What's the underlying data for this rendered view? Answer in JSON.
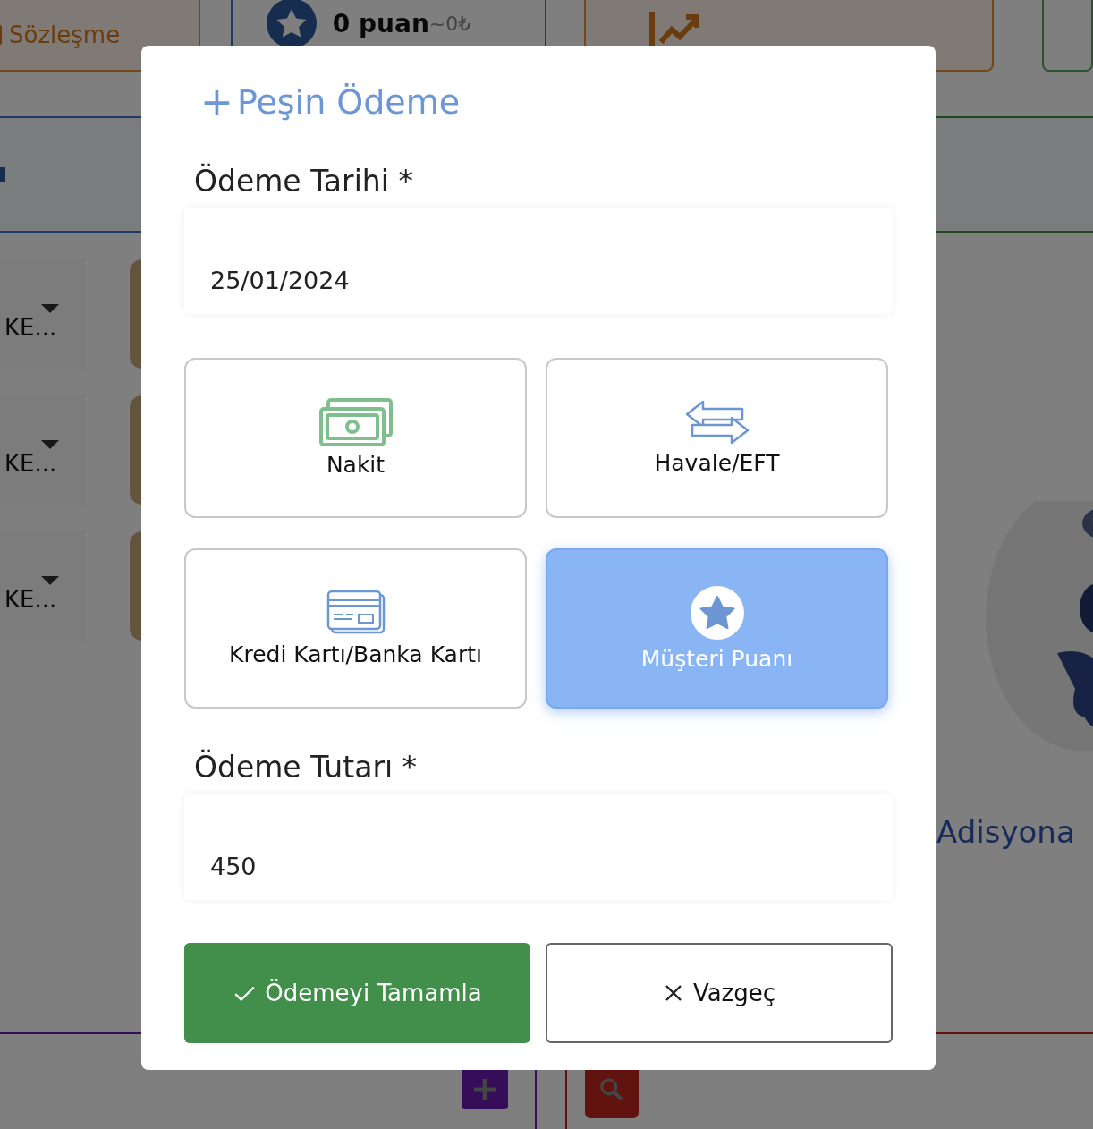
{
  "background": {
    "contract_card": {
      "label": "Sözleşme"
    },
    "points_card": {
      "value": "0 puan",
      "approx": "~0₺"
    },
    "rows": [
      {
        "label": "KE..."
      },
      {
        "label": "KE..."
      },
      {
        "label": "KE..."
      }
    ],
    "side_link": "Adisyona"
  },
  "dialog": {
    "title": "Peşin Ödeme",
    "title_icon": "+",
    "date_label": "Ödeme Tarihi *",
    "date_value": "25/01/2024",
    "methods": [
      {
        "kind": "cash",
        "label": "Nakit",
        "selected": false
      },
      {
        "kind": "transfer",
        "label": "Havale/EFT",
        "selected": false
      },
      {
        "kind": "card",
        "label": "Kredi Kartı/Banka Kartı",
        "selected": false
      },
      {
        "kind": "points",
        "label": "Müşteri Puanı",
        "selected": true
      }
    ],
    "amount_label": "Ödeme Tutarı *",
    "amount_value": "450",
    "buttons": [
      {
        "kind": "confirm",
        "label": "Ödemeyi Tamamla"
      },
      {
        "kind": "cancel",
        "label": "Vazgeç"
      }
    ]
  }
}
